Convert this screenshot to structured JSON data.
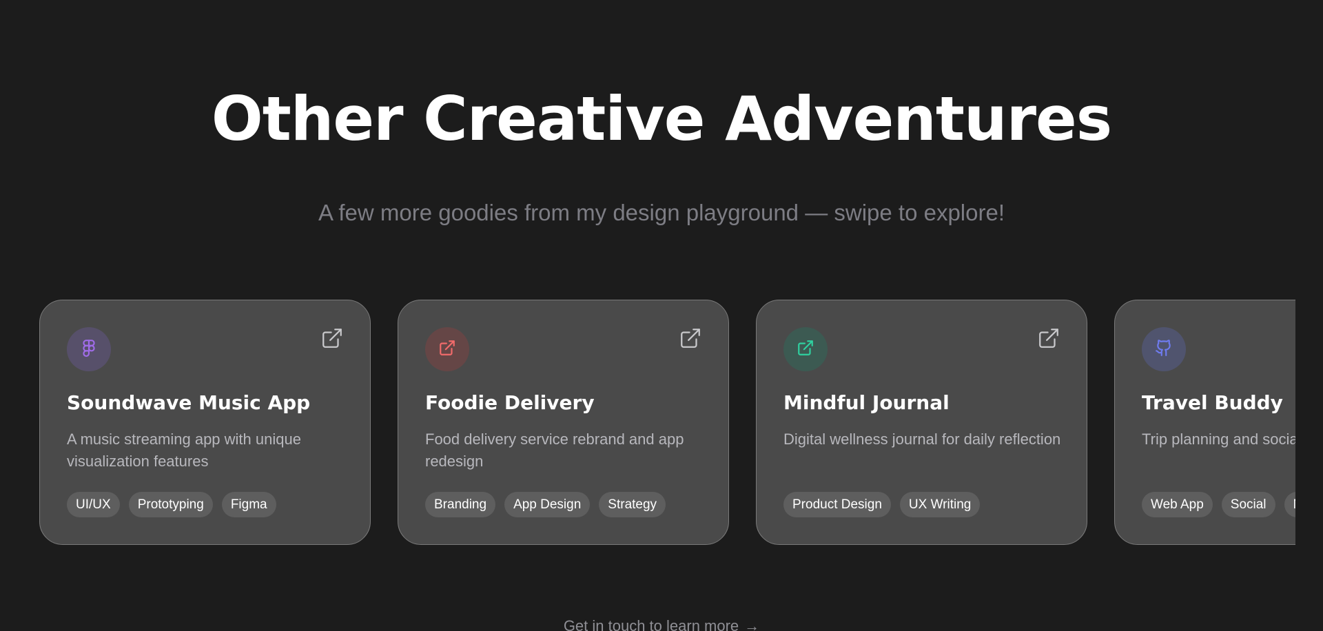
{
  "hero": {
    "title": "Other Creative Adventures",
    "subtitle": "A few more goodies from my design playground — swipe to explore!"
  },
  "cards": [
    {
      "title": "Soundwave Music App",
      "description": "A music streaming app with unique visualization features",
      "icon": "figma-icon",
      "icon_color": "#a06ce8",
      "icon_bg": "#57506a",
      "tags": [
        "UI/UX",
        "Prototyping",
        "Figma"
      ]
    },
    {
      "title": "Foodie Delivery",
      "description": "Food delivery service rebrand and app redesign",
      "icon": "external-link-icon",
      "icon_color": "#f26b6b",
      "icon_bg": "#654646",
      "tags": [
        "Branding",
        "App Design",
        "Strategy"
      ]
    },
    {
      "title": "Mindful Journal",
      "description": "Digital wellness journal for daily reflection",
      "icon": "external-link-icon",
      "icon_color": "#2fd1a0",
      "icon_bg": "#3c5a52",
      "tags": [
        "Product Design",
        "UX Writing"
      ]
    },
    {
      "title": "Travel Buddy",
      "description": "Trip planning and social travel platform",
      "icon": "github-icon",
      "icon_color": "#6f7cf0",
      "icon_bg": "#50546e",
      "tags": [
        "Web App",
        "Social",
        "Maps"
      ]
    }
  ],
  "cta": {
    "label": "Get in touch to learn more",
    "arrow": "→"
  }
}
